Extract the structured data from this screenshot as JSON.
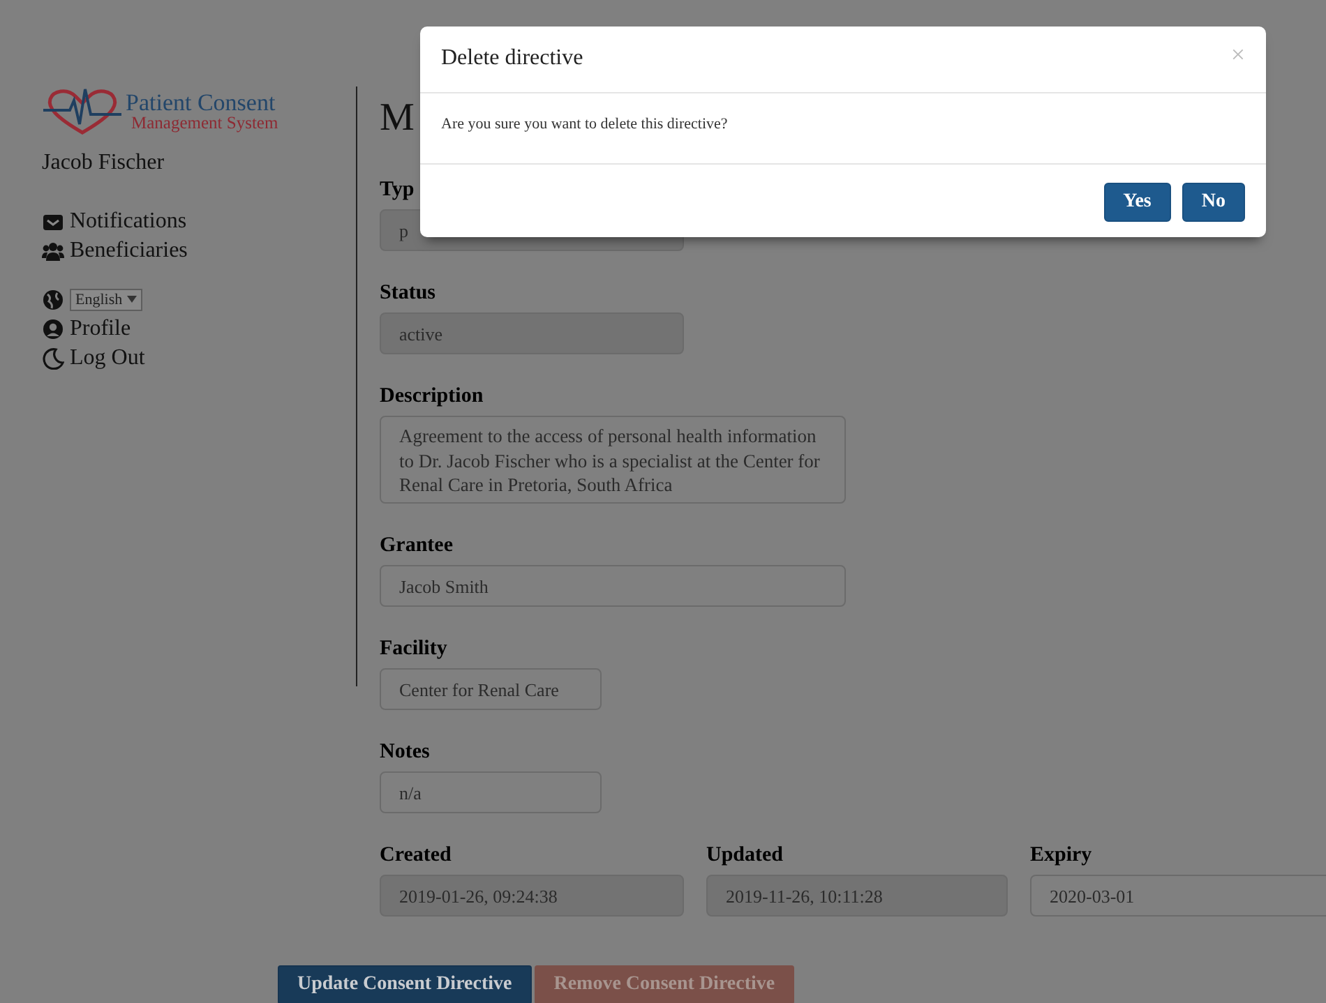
{
  "sidebar": {
    "logo": {
      "title": "Patient Consent",
      "subtitle": "Management System"
    },
    "user": "Jacob Fischer",
    "nav": [
      {
        "label": "Notifications"
      },
      {
        "label": "Beneficiaries"
      }
    ],
    "language": {
      "value": "English"
    },
    "account": [
      {
        "label": "Profile"
      },
      {
        "label": "Log Out"
      }
    ]
  },
  "main": {
    "heading": "M",
    "fields": [
      {
        "label": "Typ",
        "value": "p",
        "kind": "short",
        "disabled": true
      },
      {
        "label": "Status",
        "value": "active",
        "kind": "short",
        "disabled": true
      },
      {
        "label": "Description",
        "value": "Agreement to the access of personal health information to Dr. Jacob Fischer who is a specialist at the Center for Renal Care in Pretoria, South Africa",
        "kind": "textarea",
        "disabled": false
      },
      {
        "label": "Grantee",
        "value": "Jacob Smith",
        "kind": "long",
        "disabled": false
      },
      {
        "label": "Facility",
        "value": "Center for Renal Care",
        "kind": "small",
        "disabled": false
      },
      {
        "label": "Notes",
        "value": "n/a",
        "kind": "small",
        "disabled": false
      }
    ],
    "dates": [
      {
        "label": "Created",
        "value": "2019-01-26, 09:24:38",
        "disabled": true
      },
      {
        "label": "Updated",
        "value": "2019-11-26, 10:11:28",
        "disabled": true
      },
      {
        "label": "Expiry",
        "value": "2020-03-01",
        "disabled": false
      }
    ]
  },
  "actions": [
    {
      "label": "Update Consent Directive",
      "kind": "primary"
    },
    {
      "label": "Remove Consent Directive",
      "kind": "danger"
    }
  ],
  "modal": {
    "title": "Delete directive",
    "close": "×",
    "message": "Are you sure you want to delete this directive?",
    "buttons": [
      {
        "label": "Yes"
      },
      {
        "label": "No"
      }
    ]
  }
}
